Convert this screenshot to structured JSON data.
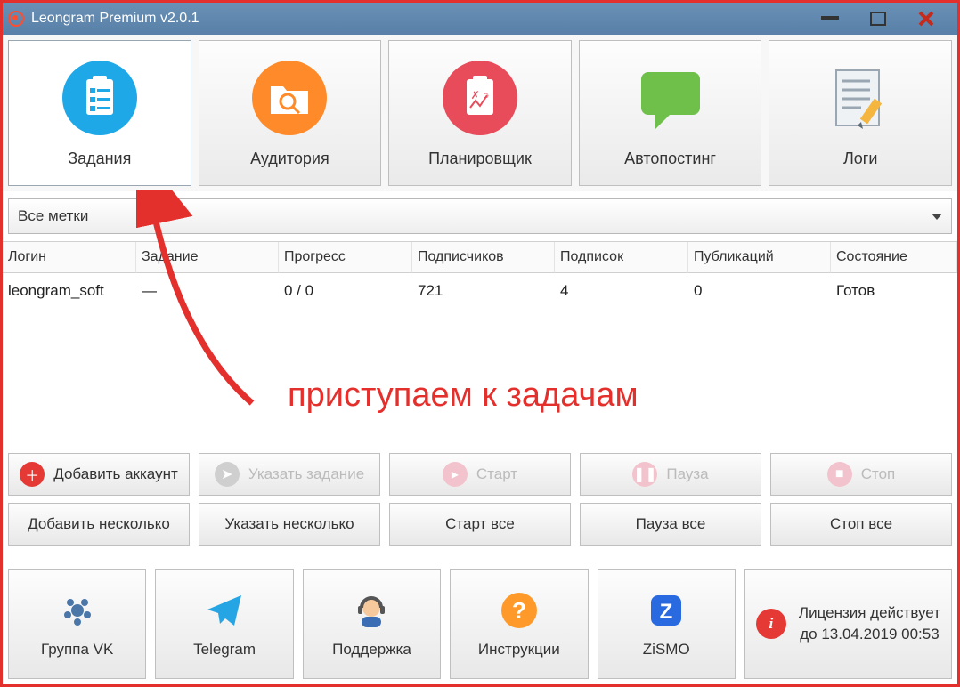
{
  "window": {
    "title": "Leongram Premium v2.0.1"
  },
  "tabs": [
    {
      "label": "Задания"
    },
    {
      "label": "Аудитория"
    },
    {
      "label": "Планировщик"
    },
    {
      "label": "Автопостинг"
    },
    {
      "label": "Логи"
    }
  ],
  "filter": {
    "selected": "Все метки"
  },
  "table": {
    "headers": {
      "login": "Логин",
      "task": "Задание",
      "progress": "Прогресс",
      "followers": "Подписчиков",
      "following": "Подписок",
      "posts": "Публикаций",
      "status": "Состояние"
    },
    "rows": [
      {
        "login": "leongram_soft",
        "task": "—",
        "progress": "0 / 0",
        "followers": "721",
        "following": "4",
        "posts": "0",
        "status": "Готов"
      }
    ]
  },
  "annotation": {
    "text": "приступаем к задачам"
  },
  "actions": {
    "add_account": "Добавить аккаунт",
    "set_task": "Указать задание",
    "start": "Старт",
    "pause": "Пауза",
    "stop": "Стоп",
    "add_multiple": "Добавить несколько",
    "set_multiple": "Указать несколько",
    "start_all": "Старт все",
    "pause_all": "Пауза все",
    "stop_all": "Стоп все"
  },
  "bottom": {
    "vk": "Группа VK",
    "telegram": "Telegram",
    "support": "Поддержка",
    "instructions": "Инструкции",
    "zismo": "ZiSMO"
  },
  "license": {
    "line1": "Лицензия действует",
    "line2": "до 13.04.2019 00:53"
  }
}
